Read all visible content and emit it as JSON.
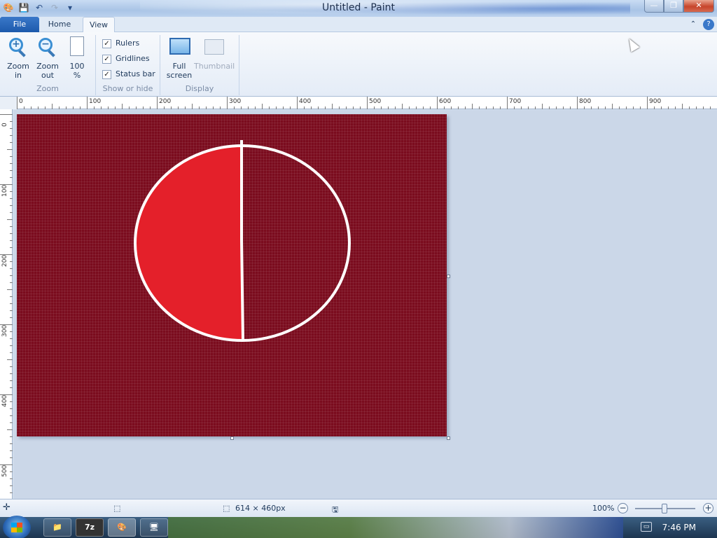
{
  "window": {
    "title": "Untitled - Paint",
    "buttons": {
      "minimize": "—",
      "restore": "❐",
      "close": "✕"
    }
  },
  "quick_access": [
    "save-icon",
    "undo-icon",
    "redo-icon",
    "customize-icon"
  ],
  "tabs": {
    "file": "File",
    "home": "Home",
    "view": "View",
    "help": "?"
  },
  "ribbon": {
    "zoom": {
      "title": "Zoom",
      "zoom_in": [
        "Zoom",
        "in"
      ],
      "zoom_out": [
        "Zoom",
        "out"
      ],
      "hundred": [
        "100",
        "%"
      ]
    },
    "show_hide": {
      "title": "Show or hide",
      "rulers": {
        "label": "Rulers",
        "checked": true
      },
      "gridlines": {
        "label": "Gridlines",
        "checked": true
      },
      "status_bar": {
        "label": "Status bar",
        "checked": true
      }
    },
    "display": {
      "title": "Display",
      "full_screen": [
        "Full",
        "screen"
      ],
      "thumbnail": "Thumbnail"
    }
  },
  "rulers": {
    "horizontal_labels": [
      "0",
      "100",
      "200",
      "300",
      "400",
      "500",
      "600",
      "700",
      "800",
      "900"
    ],
    "vertical_labels": [
      "0",
      "100",
      "200",
      "300",
      "400",
      "500"
    ]
  },
  "canvas": {
    "background_color": "#7b0c1e",
    "left_half_color": "#e4202a",
    "outline_color": "#ffffff"
  },
  "status_bar": {
    "canvas_size": "614 × 460px",
    "zoom_level": "100%",
    "zoom_out_btn": "−",
    "zoom_in_btn": "+"
  },
  "taskbar": {
    "buttons": [
      "explorer-icon",
      "7zip-icon",
      "paint-icon",
      "remote-desktop-icon"
    ],
    "sevenzip_label": "7z",
    "clock": "7:46 PM"
  }
}
